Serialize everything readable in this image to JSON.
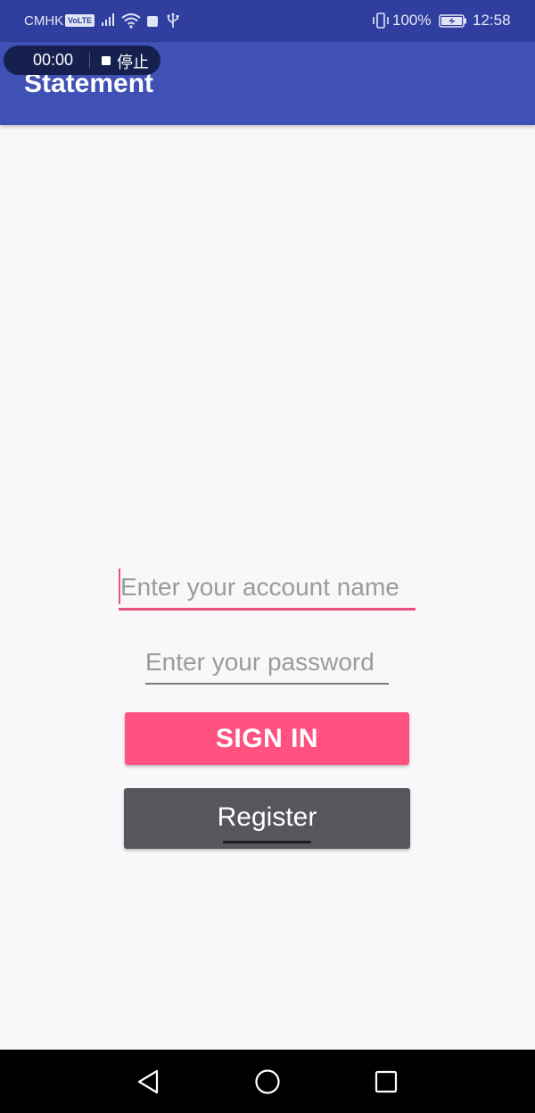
{
  "status_bar": {
    "carrier": "CMHK",
    "volte": "VoLTE",
    "battery_percent": "100%",
    "time": "12:58",
    "icons": [
      "signal-icon",
      "wifi-icon",
      "app-notification-icon",
      "usb-icon",
      "vibrate-icon",
      "battery-charging-icon"
    ]
  },
  "app_bar": {
    "title": "Statement"
  },
  "recording": {
    "elapsed": "00:00",
    "stop_label": "停止"
  },
  "form": {
    "account_placeholder": "Enter your account name",
    "password_placeholder": "Enter your password",
    "signin_label": "SIGN IN",
    "register_label": "Register"
  },
  "colors": {
    "status_bar": "#303f9f",
    "app_bar": "#3f51b5",
    "accent": "#ff5280",
    "register_button": "#55575d",
    "background": "#faf7fa"
  },
  "nav_bar": {
    "buttons": [
      "back-icon",
      "home-icon",
      "recents-icon"
    ]
  }
}
